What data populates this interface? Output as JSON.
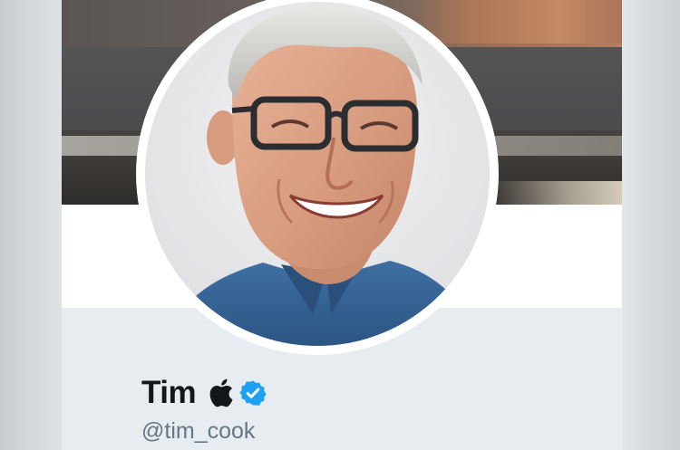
{
  "profile": {
    "display_name": "Tim",
    "handle": "@tim_cook",
    "badges": [
      "apple-logo-icon",
      "verified-badge-icon"
    ],
    "avatar_icon": "profile-photo"
  },
  "colors": {
    "name": "#14171a",
    "handle": "#657786",
    "verified": "#1da1f2",
    "profile_background": "#e6ecf0",
    "card_background": "#ffffff"
  }
}
